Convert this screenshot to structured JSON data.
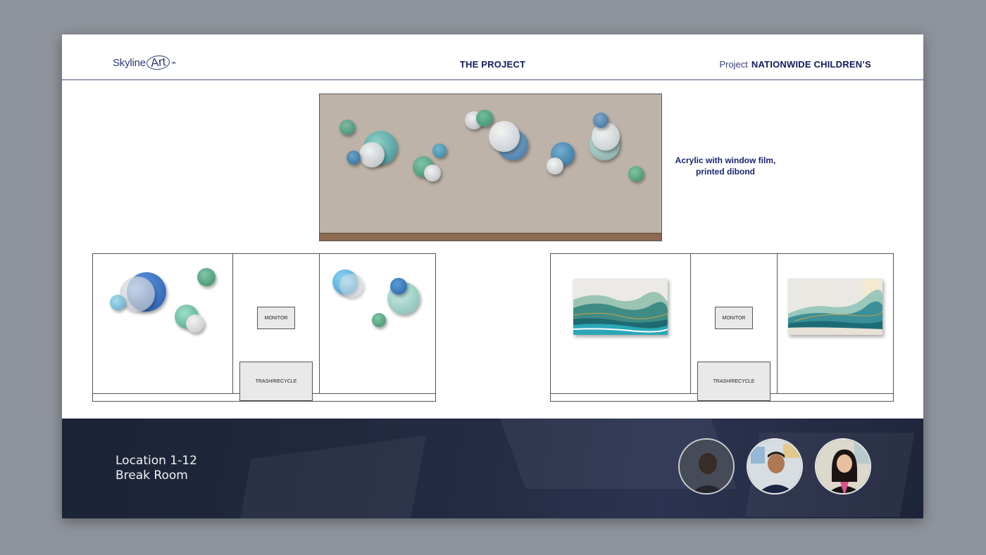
{
  "header": {
    "logo_text": "Skyline",
    "logo_art": "Art",
    "title": "THE PROJECT",
    "project_label": "Project",
    "project_name": "NATIONWIDE CHILDREN’S"
  },
  "elevation": {
    "material_note_line1": "Acrylic with window film,",
    "material_note_line2": "printed dibond"
  },
  "plans": [
    {
      "monitor_label": "MONITOR",
      "trash_label": "TRASH/RECYCLE"
    },
    {
      "monitor_label": "MONITOR",
      "trash_label": "TRASH/RECYCLE"
    }
  ],
  "footer": {
    "location_line1": "Location 1-12",
    "location_line2": "Break Room",
    "avatars": [
      "avatar-person-1",
      "avatar-person-2",
      "avatar-person-3"
    ]
  },
  "colors": {
    "navy": "#14195e",
    "wall": "#bdb3a8",
    "floor": "#8d6a52",
    "footer_bg": "#1c2336",
    "page_bg": "#8f939b"
  }
}
